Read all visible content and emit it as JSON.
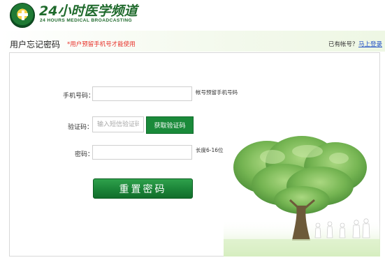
{
  "header": {
    "logo_cn": "24小时医学频道",
    "logo_en": "24 HOURS MEDICAL BROADCASTING"
  },
  "title_row": {
    "title": "用户忘记密码",
    "notice": "*用户预留手机号才能使用",
    "have_account": "已有帐号？",
    "login_link": "马上登录"
  },
  "form": {
    "phone": {
      "label": "手机号码：",
      "value": "",
      "placeholder": "",
      "hint": "帐号预留手机号码"
    },
    "code": {
      "label": "验证码：",
      "value": "",
      "placeholder": "输入短信验证码",
      "button": "获取验证码"
    },
    "password": {
      "label": "密码：",
      "value": "",
      "placeholder": "",
      "hint": "长度6-16位"
    },
    "submit": "重置密码"
  },
  "colors": {
    "brand_green": "#1a8a3a",
    "notice_red": "#e8322a",
    "link_blue": "#1f4fc5"
  }
}
